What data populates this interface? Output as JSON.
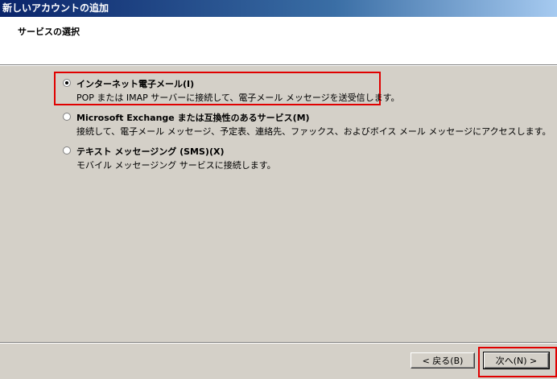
{
  "window": {
    "title": "新しいアカウントの追加"
  },
  "header": {
    "title": "サービスの選択"
  },
  "options": [
    {
      "label": "インターネット電子メール(I)",
      "description": "POP または IMAP サーバーに接続して、電子メール メッセージを送受信します。",
      "selected": true
    },
    {
      "label": "Microsoft Exchange または互換性のあるサービス(M)",
      "description": "接続して、電子メール メッセージ、予定表、連絡先、ファックス、およびボイス メール メッセージにアクセスします。",
      "selected": false
    },
    {
      "label": "テキスト メッセージング (SMS)(X)",
      "description": "モバイル メッセージング サービスに接続します。",
      "selected": false
    }
  ],
  "buttons": {
    "back": "< 戻る(B)",
    "next": "次へ(N) >"
  },
  "colors": {
    "highlight": "#e00000",
    "titlebar": "#0a246a",
    "dialog_bg": "#d4d0c8"
  }
}
